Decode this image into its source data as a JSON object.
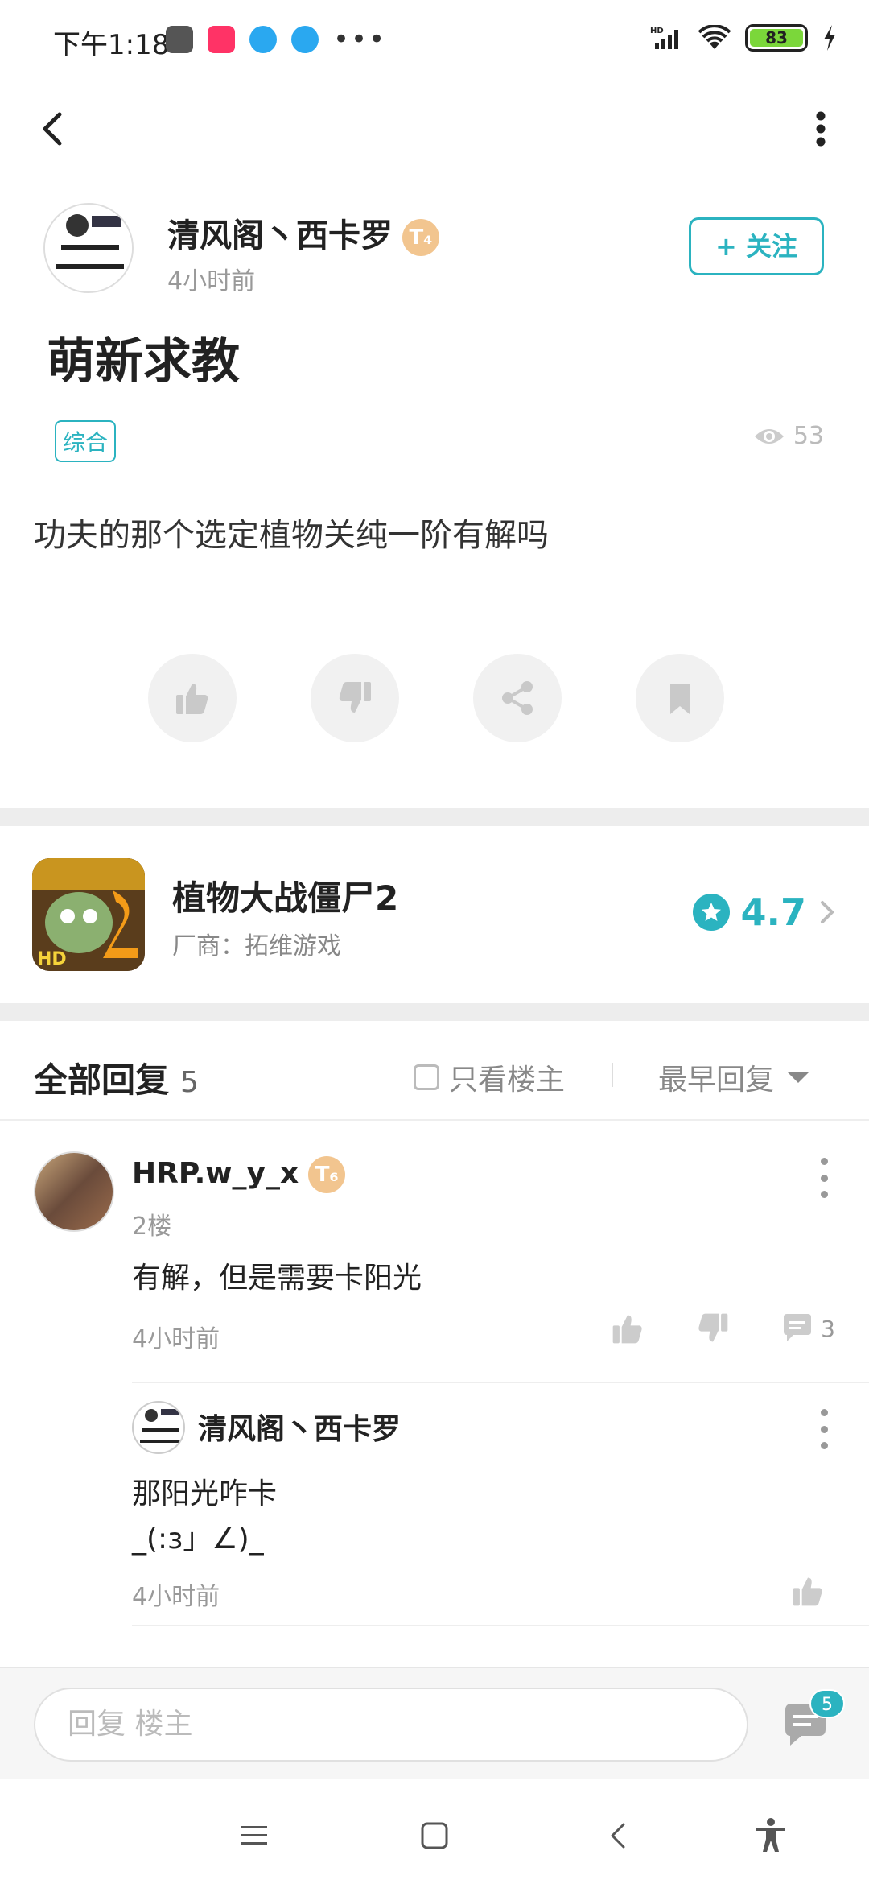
{
  "status_bar": {
    "time": "下午1:18",
    "battery": "83",
    "icons": [
      "mi-app-icon",
      "bilibili-app-icon",
      "blue-app-icon",
      "blue-app-icon-2",
      "more-icon",
      "hd-signal-icon",
      "wifi-icon",
      "battery-icon",
      "charging-icon"
    ]
  },
  "author": {
    "name": "清风阁丶西卡罗",
    "level": "T₄",
    "time": "4小时前",
    "follow_label": "+ 关注"
  },
  "post": {
    "title": "萌新求教",
    "tag": "综合",
    "views": "53",
    "body": "功夫的那个选定植物关纯一阶有解吗"
  },
  "game": {
    "name": "植物大战僵尸2",
    "vendor": "厂商：拓维游戏",
    "rating": "4.7"
  },
  "replies_header": {
    "title": "全部回复",
    "count": "5",
    "only_op": "只看楼主",
    "sort": "最早回复"
  },
  "reply": {
    "name": "HRP.w_y_x",
    "level": "T₆",
    "floor": "2楼",
    "text": "有解，但是需要卡阳光",
    "time": "4小时前",
    "comment_count": "3"
  },
  "subreply": {
    "name": "清风阁丶西卡罗",
    "line1": "那阳光咋卡",
    "line2": "_(:з」∠)_",
    "time": "4小时前"
  },
  "input": {
    "placeholder": "回复  楼主",
    "badge": "5"
  },
  "colors": {
    "accent": "#2bb3c0",
    "level_gold": "#f2c58f"
  }
}
